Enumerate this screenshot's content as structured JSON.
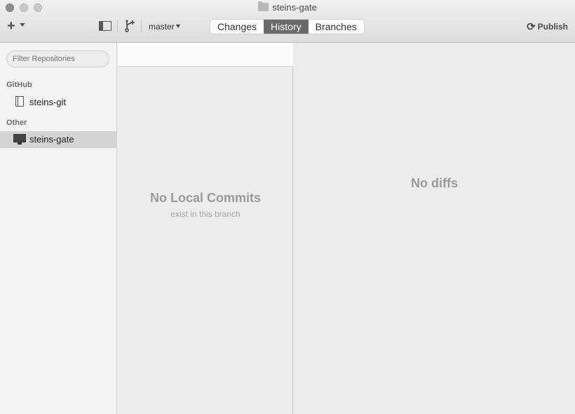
{
  "window": {
    "title": "steins-gate"
  },
  "toolbar": {
    "add_label": "+",
    "branch_name": "master",
    "tabs": [
      {
        "label": "Changes",
        "active": false
      },
      {
        "label": "History",
        "active": true
      },
      {
        "label": "Branches",
        "active": false
      }
    ],
    "publish_label": "Publish",
    "icons": [
      "folder-icon",
      "add-icon",
      "sidebar-toggle-icon",
      "branch-icon",
      "sync-icon"
    ]
  },
  "sidebar": {
    "filter_placeholder": "Filter Repositories",
    "sections": [
      {
        "heading": "GitHub",
        "repos": [
          {
            "name": "steins-git",
            "icon": "book-icon",
            "selected": false
          }
        ]
      },
      {
        "heading": "Other",
        "repos": [
          {
            "name": "steins-gate",
            "icon": "monitor-icon",
            "selected": true
          }
        ]
      }
    ]
  },
  "history": {
    "empty_title": "No Local Commits",
    "empty_subtitle": "exist in this branch"
  },
  "diff": {
    "empty_title": "No diffs"
  },
  "colors": {
    "active_tab": "#6a6a6a",
    "selected_row": "#d4d4d4",
    "empty_text": "#9a9a9a"
  }
}
